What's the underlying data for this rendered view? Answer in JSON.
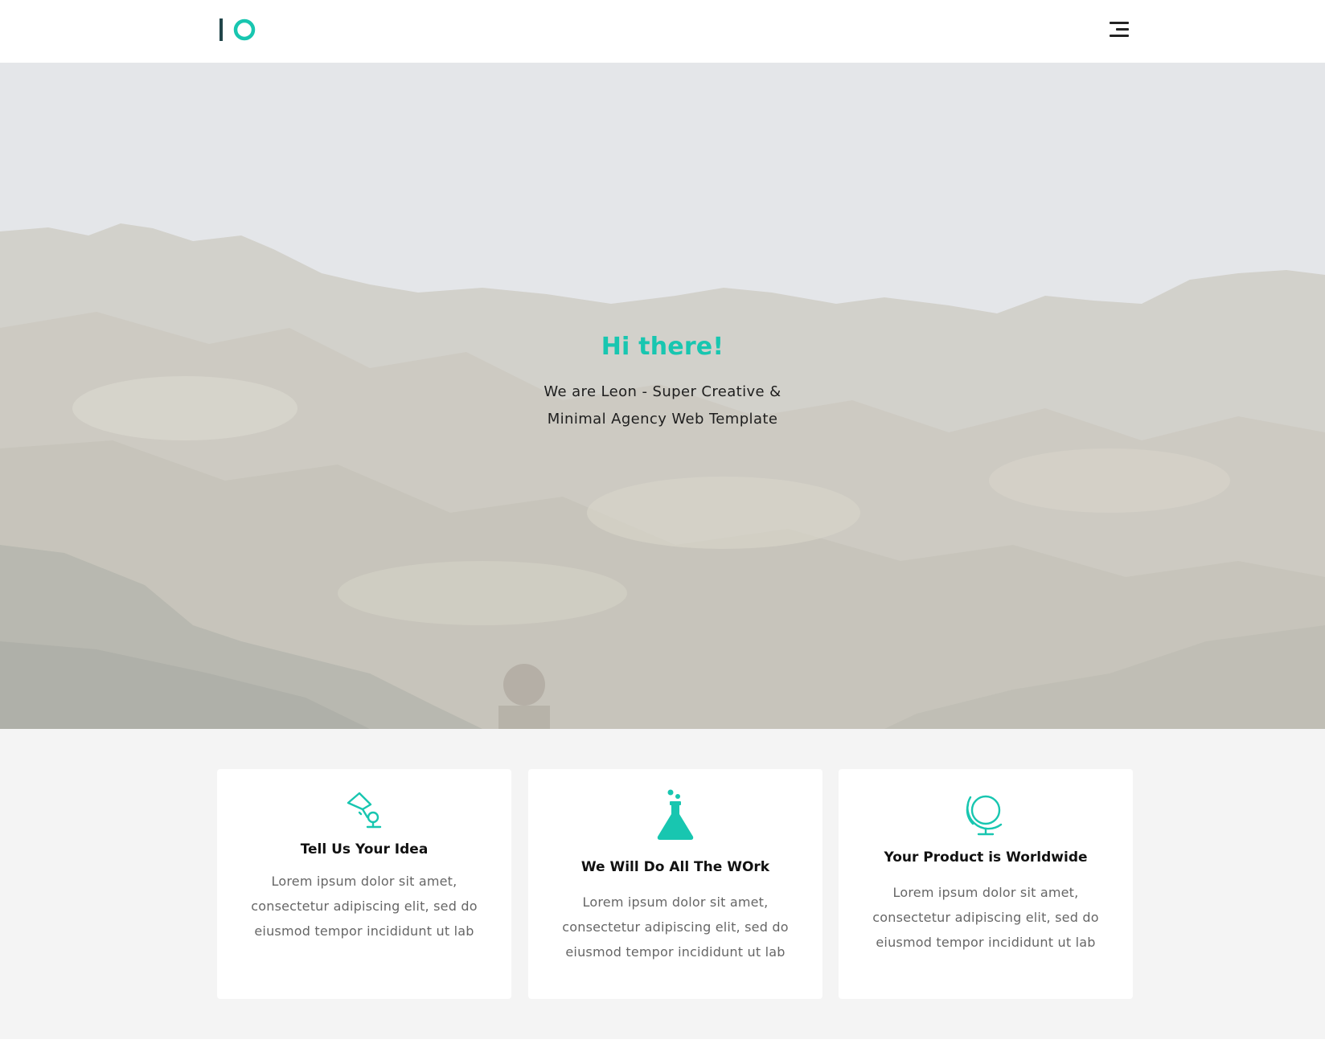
{
  "brand": {
    "logo_icon": "io-logo",
    "accent_color": "#18c6b0",
    "dark_color": "#22464a"
  },
  "header": {
    "menu_icon": "hamburger-menu-icon"
  },
  "hero": {
    "title": "Hi there!",
    "subtitle": "We are Leon - Super Creative & Minimal Agency Web Template",
    "background": "mountain-landscape-photo"
  },
  "features": [
    {
      "icon": "desk-lamp-icon",
      "title": "Tell Us Your Idea",
      "text": "Lorem ipsum dolor sit amet, consectetur adipiscing elit, sed do eiusmod tempor incididunt ut lab"
    },
    {
      "icon": "flask-icon",
      "title": "We Will Do All The WOrk",
      "text": "Lorem ipsum dolor sit amet, consectetur adipiscing elit, sed do eiusmod tempor incididunt ut lab"
    },
    {
      "icon": "globe-icon",
      "title": "Your Product is Worldwide",
      "text": "Lorem ipsum dolor sit amet, consectetur adipiscing elit, sed do eiusmod tempor incididunt ut lab"
    }
  ]
}
